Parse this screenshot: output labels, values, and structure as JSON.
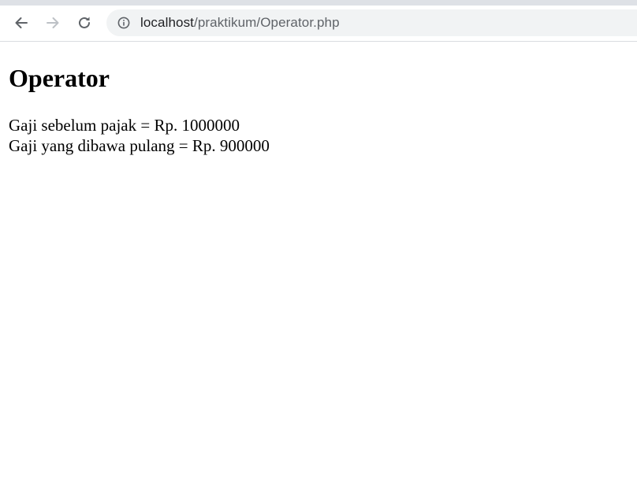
{
  "browser": {
    "url_host": "localhost",
    "url_path": "/praktikum/Operator.php",
    "icons": {
      "back": "arrow-left-icon",
      "forward": "arrow-right-icon",
      "reload": "reload-icon",
      "site_info": "info-circle-icon"
    }
  },
  "page": {
    "title": "Operator",
    "lines": [
      "Gaji sebelum pajak = Rp. 1000000",
      "Gaji yang dibawa pulang = Rp. 900000"
    ]
  },
  "colors": {
    "toolbar_strip": "#dee1e6",
    "omnibox_bg": "#f1f3f4",
    "icon_active": "#5f6368",
    "icon_disabled": "#bdc1c6",
    "text": "#000000"
  }
}
